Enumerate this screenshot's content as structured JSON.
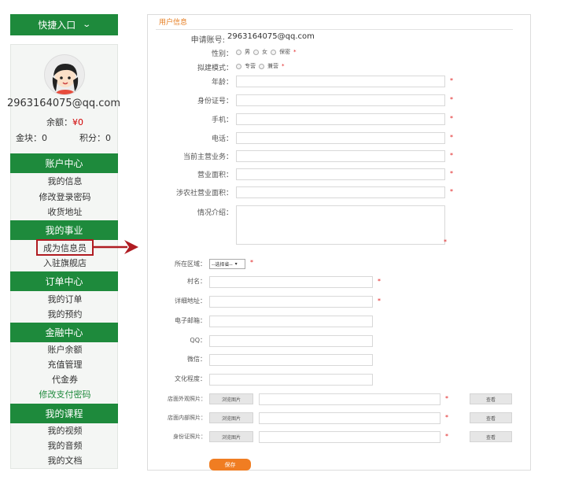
{
  "quick_entry": {
    "label": "快捷入口"
  },
  "user": {
    "email": "2963164075@qq.com",
    "balance_label": "余额：",
    "balance_value": "¥0",
    "coins_label": "金块：0",
    "points_label": "积分：0"
  },
  "sidebar": {
    "account": {
      "title": "账户中心",
      "items": [
        "我的信息",
        "修改登录密码",
        "收货地址"
      ]
    },
    "career": {
      "title": "我的事业",
      "items": [
        "成为信息员",
        "入驻旗舰店"
      ]
    },
    "orders": {
      "title": "订单中心",
      "items": [
        "我的订单",
        "我的预约"
      ]
    },
    "finance": {
      "title": "金融中心",
      "items": [
        "账户余额",
        "充值管理",
        "代金券",
        "修改支付密码"
      ]
    },
    "courses": {
      "title": "我的课程",
      "items": [
        "我的视频",
        "我的音频",
        "我的文档"
      ]
    }
  },
  "form": {
    "title": "用户信息",
    "account_label": "申请账号:",
    "account_value": "2963164075@qq.com",
    "gender_label": "性别：",
    "gender_options": [
      "男",
      "女",
      "保密"
    ],
    "mode_label": "拟建模式：",
    "mode_options": [
      "专营",
      "兼营"
    ],
    "required_mark": "*",
    "fields": {
      "age": "年龄：",
      "id_card": "身份证号：",
      "mobile": "手机：",
      "phone": "电话：",
      "main_business": "当前主营业务：",
      "area": "营业面积：",
      "agri_area": "涉农社营业面积：",
      "intro": "情况介绍：",
      "region": "所在区域：",
      "village": "村名：",
      "address": "详细地址：",
      "email": "电子邮箱：",
      "qq": "QQ：",
      "wechat": "微信：",
      "education": "文化程度：",
      "photo_outside": "店面外观照片：",
      "photo_inside": "店面内部照片：",
      "photo_id": "身份证照片："
    },
    "region_select": "--选择省--",
    "browse_label": "浏览图片",
    "view_label": "查看",
    "save_label": "保存"
  }
}
